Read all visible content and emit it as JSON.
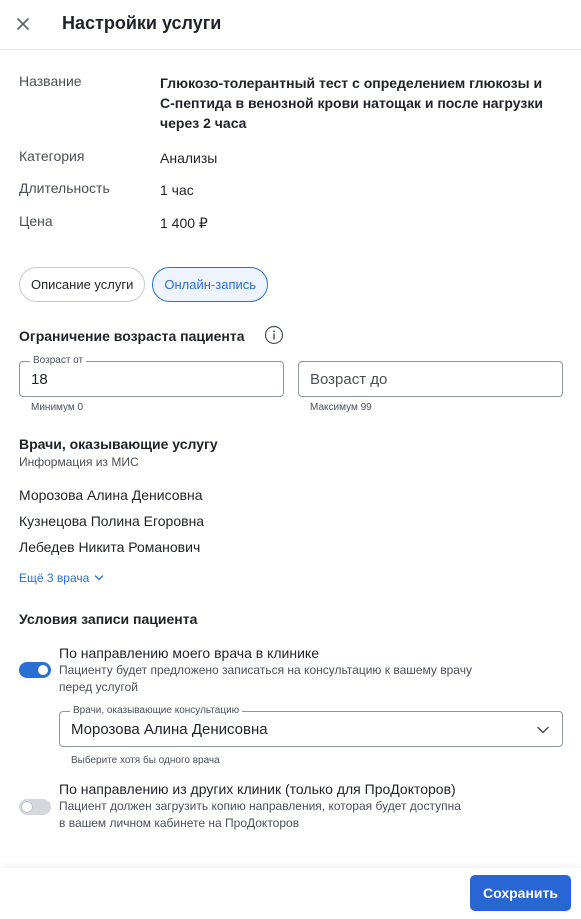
{
  "header": {
    "title": "Настройки услуги"
  },
  "service": {
    "name_label": "Название",
    "name_value_lines": [
      "Глюкозо-толерантный тест с определением глюкозы и",
      "С-пептида в венозной крови натощак и после нагрузки",
      "через 2 часа"
    ],
    "category_label": "Категория",
    "category_value": "Анализы",
    "duration_label": "Длительность",
    "duration_value": "1 час",
    "price_label": "Цена",
    "price_value": "1 400 ₽"
  },
  "tabs": [
    {
      "label": "Описание услуги",
      "active": false
    },
    {
      "label": "Онлайн-запись",
      "active": true
    }
  ],
  "age_limit": {
    "title": "Ограничение возраста пациента",
    "from_legend": "Возраст от",
    "from_value": "18",
    "from_helper": "Минимум 0",
    "to_placeholder": "Возраст до",
    "to_helper": "Максимум 99"
  },
  "doctors": {
    "title": "Врачи, оказывающие услугу",
    "subtitle": "Информация из МИС",
    "list": [
      "Морозова Алина Денисовна",
      "Кузнецова Полина Егоровна",
      "Лебедев Никита Романович"
    ],
    "more_link": "Ещё 3 врача"
  },
  "conditions": {
    "title": "Условия записи пациента",
    "items": [
      {
        "title": "По направлению моего врача в клинике",
        "desc_lines": [
          "Пациенту будет предложено записаться на консультацию к вашему врачу",
          "перед услугой"
        ],
        "enabled": true
      },
      {
        "title": "По направлению из других клиник (только для ПроДокторов)",
        "desc_lines": [
          "Пациент должен загрузить копию направления, которая будет доступна",
          "в вашем личном кабинете на ПроДокторов"
        ],
        "enabled": false
      }
    ],
    "consult_select": {
      "legend": "Врачи, оказывающие консультацию",
      "value": "Морозова Алина Денисовна",
      "helper": "Выберите хотя бы одного врача"
    }
  },
  "footer": {
    "save_label": "Сохранить"
  },
  "colors": {
    "accent": "#2766d4",
    "tab_active_bg": "#eef4ff",
    "toggle_off": "#d4d7dc"
  }
}
